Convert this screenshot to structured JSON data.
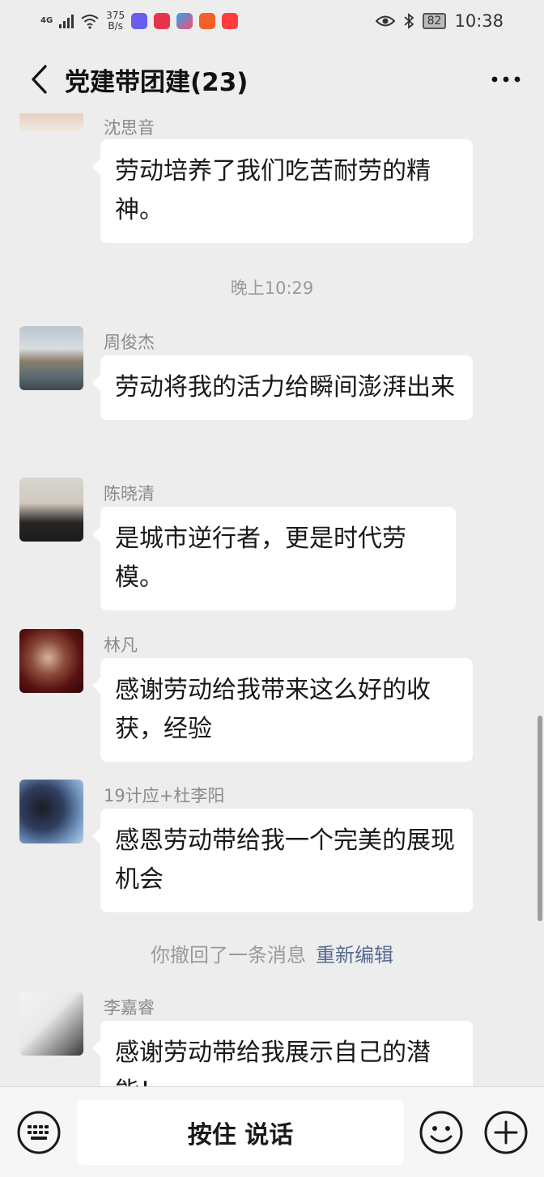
{
  "status_bar": {
    "signal": "4G",
    "speed_value": "375",
    "speed_unit": "B/s",
    "battery": "82",
    "time": "10:38"
  },
  "nav": {
    "back_icon": "chevron-left-icon",
    "title": "党建带团建(23)",
    "more_icon": "more-icon"
  },
  "messages": [
    {
      "sender": "沈思音",
      "text": "劳动培养了我们吃苦耐劳的精神。"
    },
    {
      "sender": "周俊杰",
      "text": "劳动将我的活力给瞬间澎湃出来"
    },
    {
      "sender": "陈晓清",
      "text": "是城市逆行者，更是时代劳模。"
    },
    {
      "sender": "林凡",
      "text": "感谢劳动给我带来这么好的收获，经验"
    },
    {
      "sender": "19计应+杜李阳",
      "text": "感恩劳动带给我一个完美的展现机会"
    },
    {
      "sender": "李嘉睿",
      "text": "感谢劳动带给我展示自己的潜能！"
    }
  ],
  "timestamp": "晚上10:29",
  "recall": {
    "text": "你撤回了一条消息",
    "action": "重新编辑"
  },
  "input_bar": {
    "voice_label": "按住 说话",
    "keyboard_icon": "keyboard-icon",
    "emoji_icon": "emoji-icon",
    "plus_icon": "plus-circle-icon"
  },
  "colors": {
    "background": "#ededed",
    "bubble": "#ffffff",
    "link": "#576b95"
  }
}
